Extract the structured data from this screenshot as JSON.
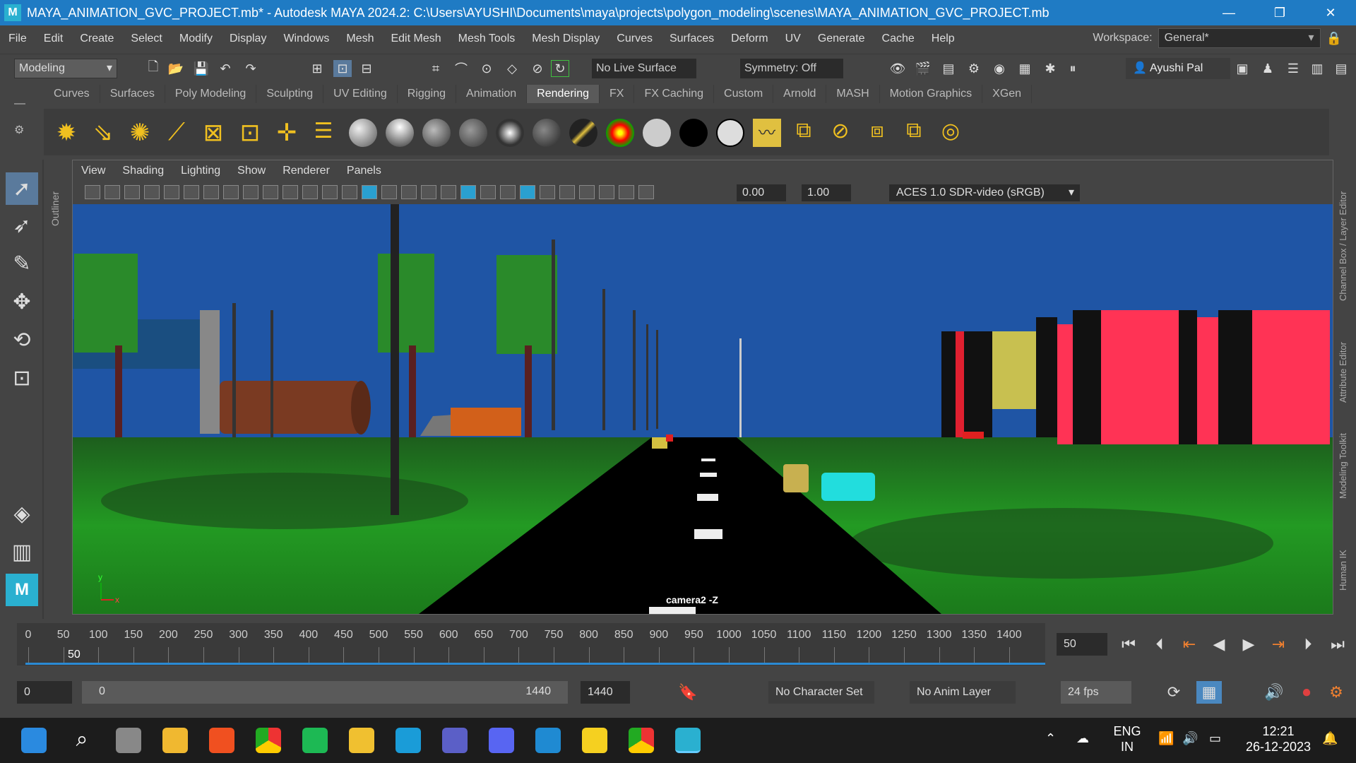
{
  "title": "MAYA_ANIMATION_GVC_PROJECT.mb* - Autodesk MAYA 2024.2: C:\\Users\\AYUSHI\\Documents\\maya\\projects\\polygon_modeling\\scenes\\MAYA_ANIMATION_GVC_PROJECT.mb",
  "app_icon": "M",
  "menu": [
    "File",
    "Edit",
    "Create",
    "Select",
    "Modify",
    "Display",
    "Windows",
    "Mesh",
    "Edit Mesh",
    "Mesh Tools",
    "Mesh Display",
    "Curves",
    "Surfaces",
    "Deform",
    "UV",
    "Generate",
    "Cache",
    "Help"
  ],
  "workspace": {
    "label": "Workspace:",
    "value": "General*"
  },
  "status": {
    "mode": "Modeling",
    "live_surface": "No Live Surface",
    "symmetry": "Symmetry: Off",
    "user": "Ayushi Pal"
  },
  "shelf_tabs": [
    "Curves",
    "Surfaces",
    "Poly Modeling",
    "Sculpting",
    "UV Editing",
    "Rigging",
    "Animation",
    "Rendering",
    "FX",
    "FX Caching",
    "Custom",
    "Arnold",
    "MASH",
    "Motion Graphics",
    "XGen"
  ],
  "active_shelf": "Rendering",
  "outliner_label": "Outliner",
  "viewport": {
    "menus": [
      "View",
      "Shading",
      "Lighting",
      "Show",
      "Renderer",
      "Panels"
    ],
    "exposure": "0.00",
    "gamma": "1.00",
    "colorspace": "ACES 1.0 SDR-video (sRGB)",
    "camera": "camera2 -Z",
    "axis_y": "y",
    "axis_x": "x"
  },
  "right_tabs": [
    "Channel Box / Layer Editor",
    "Attribute Editor",
    "Modeling Toolkit",
    "Human IK"
  ],
  "timeline": {
    "ticks": [
      "0",
      "50",
      "100",
      "150",
      "200",
      "250",
      "300",
      "350",
      "400",
      "450",
      "500",
      "550",
      "600",
      "650",
      "700",
      "750",
      "800",
      "850",
      "900",
      "950",
      "1000",
      "1050",
      "1100",
      "1150",
      "1200",
      "1250",
      "1300",
      "1350",
      "1400"
    ],
    "current": "50",
    "current_field": "50"
  },
  "range": {
    "start": "0",
    "inner_start": "0",
    "inner_end": "1440",
    "end": "1440",
    "character_set": "No Character Set",
    "anim_layer": "No Anim Layer",
    "fps": "24 fps"
  },
  "taskbar": {
    "lang": "ENG",
    "region": "IN",
    "time": "12:21",
    "date": "26-12-2023"
  },
  "colors": {
    "title_bar": "#1f7bc4",
    "sky": "#1f55a5",
    "grass": "#1e8a1e",
    "building_red": "#ff3355"
  }
}
